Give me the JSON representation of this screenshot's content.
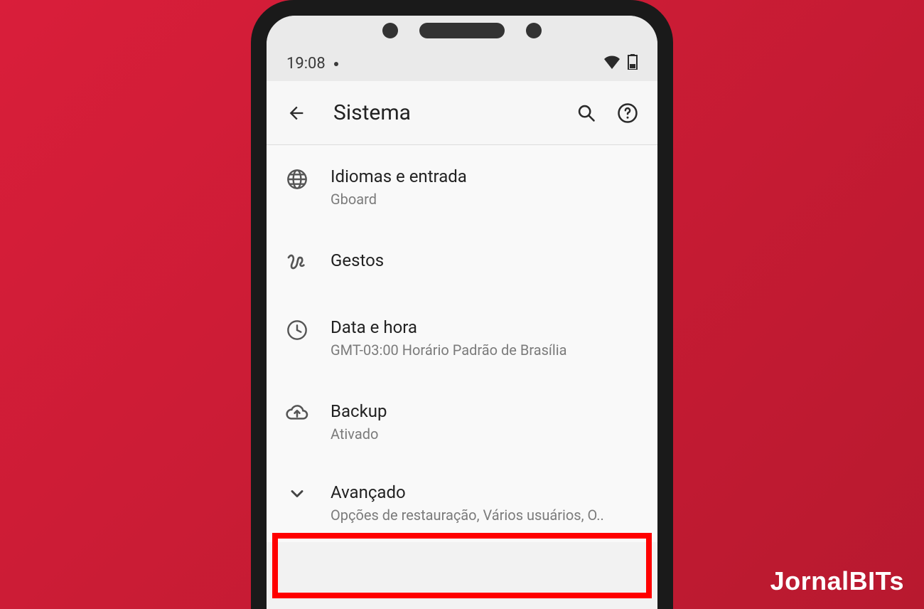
{
  "status": {
    "time": "19:08"
  },
  "appbar": {
    "title": "Sistema"
  },
  "items": [
    {
      "icon": "globe",
      "title": "Idiomas e entrada",
      "sub": "Gboard"
    },
    {
      "icon": "gesture",
      "title": "Gestos",
      "sub": ""
    },
    {
      "icon": "clock",
      "title": "Data e hora",
      "sub": "GMT-03:00 Horário Padrão de Brasília"
    },
    {
      "icon": "cloud-up",
      "title": "Backup",
      "sub": "Ativado"
    },
    {
      "icon": "chevron-down",
      "title": "Avançado",
      "sub": "Opções de restauração, Vários usuários, O.."
    }
  ],
  "watermark": {
    "text": "JornalBITs"
  }
}
